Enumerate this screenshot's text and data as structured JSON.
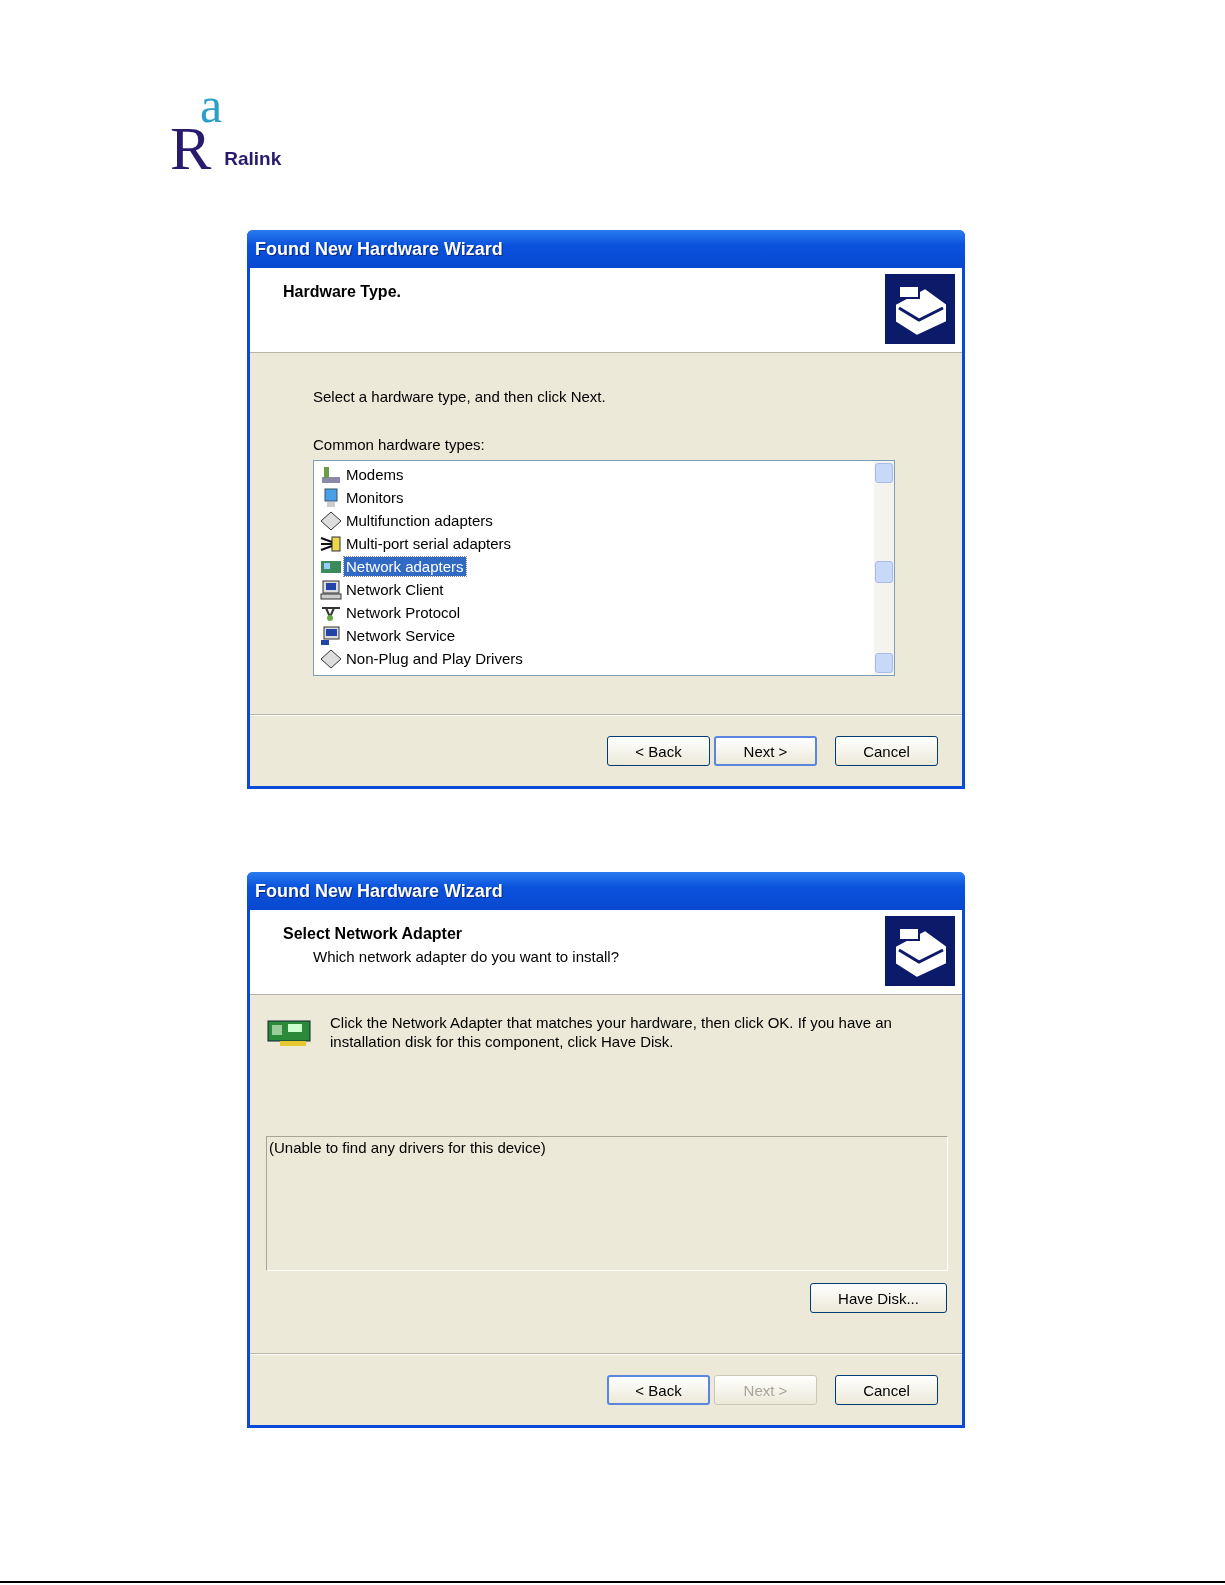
{
  "logo": {
    "letters": [
      "a",
      "R"
    ],
    "wordmark": "Ralink"
  },
  "windows": [
    {
      "title": "Found New Hardware Wizard",
      "heading": "Hardware Type.",
      "kind": "list",
      "intro": "Select a hardware type, and then click Next.",
      "list_label": "Common hardware types:",
      "items": [
        {
          "label": "Modems",
          "selected": false
        },
        {
          "label": "Monitors",
          "selected": false
        },
        {
          "label": "Multifunction adapters",
          "selected": false
        },
        {
          "label": "Multi-port serial adapters",
          "selected": false
        },
        {
          "label": "Network adapters",
          "selected": true
        },
        {
          "label": "Network Client",
          "selected": false
        },
        {
          "label": "Network Protocol",
          "selected": false
        },
        {
          "label": "Network Service",
          "selected": false
        },
        {
          "label": "Non-Plug and Play Drivers",
          "selected": false
        }
      ],
      "buttons": [
        {
          "label": "< Back",
          "default": false,
          "disabled": false
        },
        {
          "label": "Next >",
          "default": true,
          "disabled": false
        },
        {
          "label": "Cancel",
          "default": false,
          "disabled": false
        }
      ]
    },
    {
      "title": "Found New Hardware Wizard",
      "heading": "Select Network Adapter",
      "subheading": "Which network adapter do you want to install?",
      "kind": "adapter",
      "instruction": "Click the Network Adapter that matches your hardware, then click OK. If you have an installation disk for this component, click Have Disk.",
      "drivers_message": "(Unable to find any drivers for this device)",
      "have_disk": "Have Disk...",
      "buttons": [
        {
          "label": "< Back",
          "default": true,
          "disabled": false
        },
        {
          "label": "Next >",
          "default": false,
          "disabled": true
        },
        {
          "label": "Cancel",
          "default": false,
          "disabled": false
        }
      ]
    }
  ]
}
